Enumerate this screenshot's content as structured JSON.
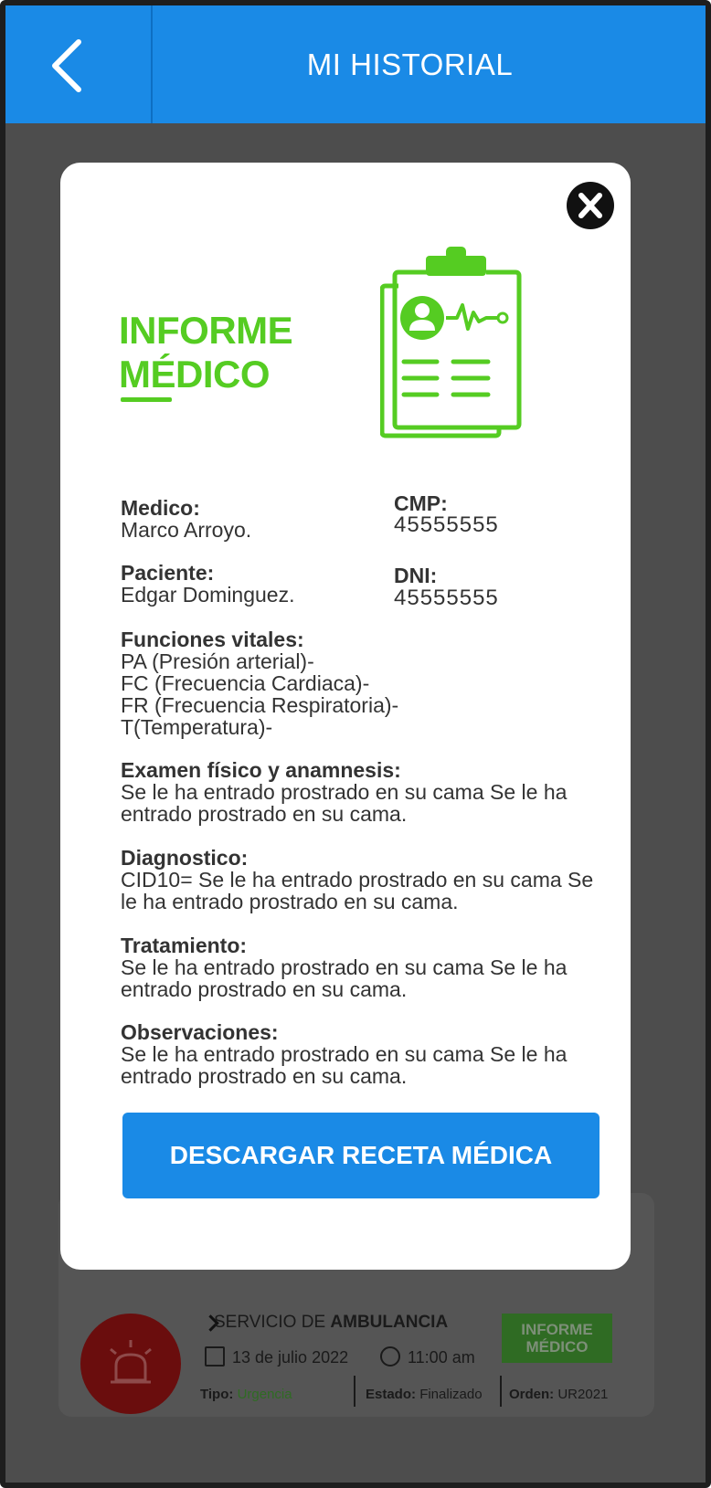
{
  "appbar": {
    "title": "MI HISTORIAL"
  },
  "background_card": {
    "service_prefix": "SERVICIO DE ",
    "service_bold": "AMBULANCIA",
    "date": "13 de julio 2022",
    "time": "11:00 am",
    "tipo_label": "Tipo:",
    "tipo_value": "Urgencia",
    "estado_label": "Estado:",
    "estado_value": "Finalizado",
    "orden_label": "Orden:",
    "orden_value": "UR2021",
    "informe_button": [
      "INFORME",
      "MÉDICO"
    ]
  },
  "modal": {
    "title_line1": "INFORME",
    "title_line2": "MÉDICO",
    "medico_label": "Medico:",
    "medico_value": "Marco Arroyo.",
    "cmp_label": "CMP:",
    "cmp_value": "45555555",
    "paciente_label": "Paciente:",
    "paciente_value": "Edgar Dominguez.",
    "dni_label": "DNI:",
    "dni_value": "45555555",
    "vitales_label": "Funciones vitales:",
    "vitales": [
      "PA (Presión arterial)-",
      "FC (Frecuencia Cardiaca)-",
      "FR (Frecuencia Respiratoria)-",
      "T(Temperatura)-"
    ],
    "examen_label": "Examen físico y anamnesis:",
    "examen_text": "Se le ha entrado prostrado en su cama Se le ha entrado prostrado en su cama.",
    "diagnostico_label": "Diagnostico:",
    "diagnostico_text": "CID10= Se le ha entrado prostrado en su cama Se le ha entrado prostrado en su cama.",
    "tratamiento_label": "Tratamiento:",
    "tratamiento_text": "Se le ha entrado prostrado en su cama Se le ha entrado prostrado en su cama.",
    "observaciones_label": "Observaciones:",
    "observaciones_text": "Se le ha entrado prostrado en su cama Se le ha entrado prostrado en su cama.",
    "download_button": "DESCARGAR RECETA MÉDICA"
  },
  "colors": {
    "primary_blue": "#1a8ae6",
    "accent_green": "#55cc22",
    "overlay": "#4d4d4d"
  },
  "icons": [
    "back-chevron-icon",
    "close-icon",
    "medical-report-icon",
    "siren-icon",
    "calendar-icon",
    "clock-icon"
  ]
}
